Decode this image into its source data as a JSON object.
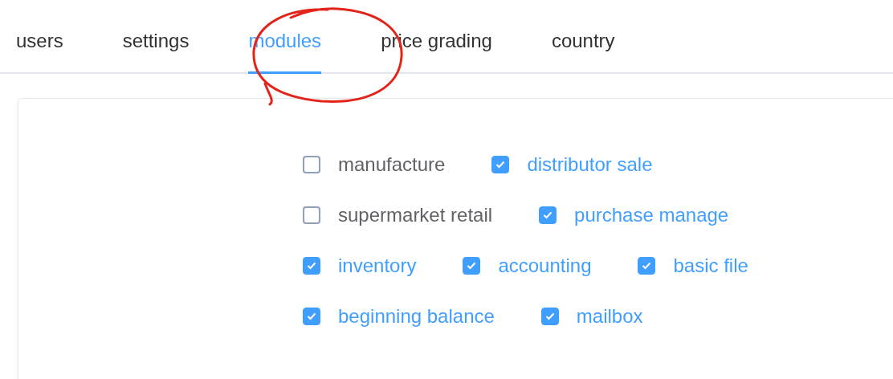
{
  "tabs": [
    {
      "label": "users",
      "selected": false
    },
    {
      "label": "settings",
      "selected": false
    },
    {
      "label": "modules",
      "selected": true
    },
    {
      "label": "price grading",
      "selected": false
    },
    {
      "label": "country",
      "selected": false
    }
  ],
  "modules": [
    [
      {
        "label": "manufacture",
        "checked": false
      },
      {
        "label": "distributor sale",
        "checked": true
      }
    ],
    [
      {
        "label": "supermarket retail",
        "checked": false
      },
      {
        "label": "purchase manage",
        "checked": true
      }
    ],
    [
      {
        "label": "inventory",
        "checked": true
      },
      {
        "label": "accounting",
        "checked": true
      },
      {
        "label": "basic file",
        "checked": true
      }
    ],
    [
      {
        "label": "beginning balance",
        "checked": true
      },
      {
        "label": "mailbox",
        "checked": true
      }
    ]
  ]
}
